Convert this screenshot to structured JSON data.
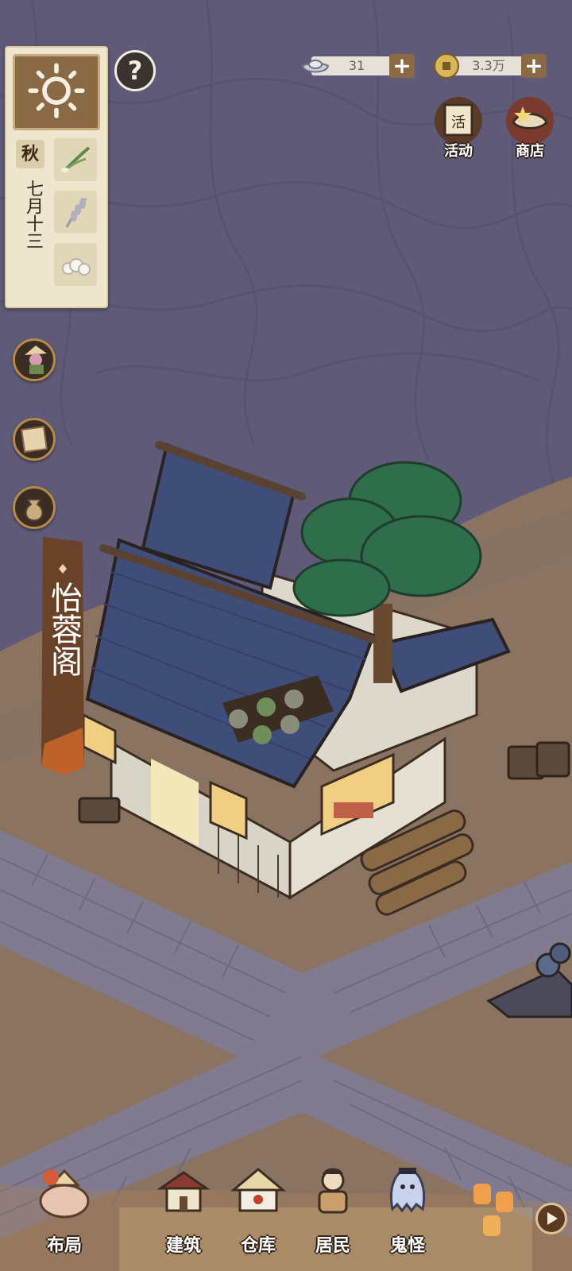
{
  "calendar": {
    "season": "秋",
    "date": "七月十三",
    "weather_icon": "sun-icon",
    "crop_slots": [
      "scallion-icon",
      "wheat-icon",
      "cotton-icon"
    ]
  },
  "currencies": [
    {
      "name": "silver-ingot",
      "value": "31"
    },
    {
      "name": "copper-coin",
      "value": "3.3万"
    }
  ],
  "features": [
    {
      "name": "activity",
      "label": "活动",
      "icon_text": "活"
    },
    {
      "name": "shop",
      "label": "商店"
    }
  ],
  "side_buttons": [
    "farmer-avatar-icon",
    "scroll-book-icon",
    "sack-icon"
  ],
  "building": {
    "name": "怡蓉阁"
  },
  "nav": {
    "layout": "布局",
    "build": "建筑",
    "warehouse": "仓库",
    "residents": "居民",
    "ghosts": "鬼怪"
  },
  "help_label": "?",
  "plus_label": "+",
  "colors": {
    "sky_night": "#5f5a78",
    "ground": "#8b7362",
    "roof": "#3f4e78",
    "panel_paper": "#efe6cf",
    "frame_brown": "#8a6a45"
  }
}
